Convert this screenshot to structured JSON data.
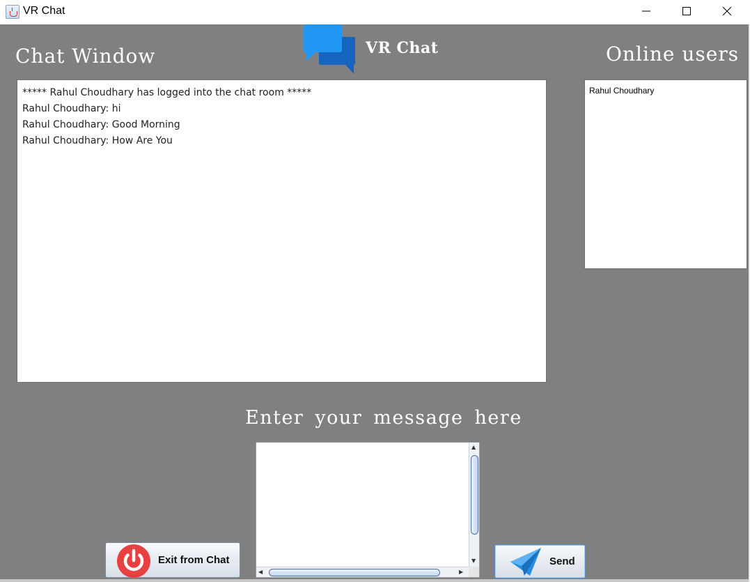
{
  "window": {
    "title": "VR Chat",
    "controls": {
      "minimize": "minimize",
      "maximize": "maximize",
      "close": "close"
    }
  },
  "brand": {
    "title": "VR Chat",
    "logo_icon": "chat-bubbles-icon",
    "logo_colors": [
      "#2196f3",
      "#1565c0"
    ]
  },
  "chat": {
    "heading": "Chat Window",
    "messages": [
      "***** Rahul Choudhary has logged into the chat room *****",
      "Rahul Choudhary: hi",
      "Rahul Choudhary: Good Morning",
      "Rahul Choudhary: How Are You"
    ]
  },
  "online": {
    "heading": "Online users",
    "users": [
      "Rahul Choudhary"
    ]
  },
  "composer": {
    "heading": "Enter your message here",
    "value": ""
  },
  "buttons": {
    "exit_label": "Exit from Chat",
    "exit_icon": "power-icon",
    "send_label": "Send",
    "send_icon": "paper-plane-icon"
  },
  "colors": {
    "background": "#808080",
    "power": "#e74040",
    "plane": "#2a8ee0"
  }
}
